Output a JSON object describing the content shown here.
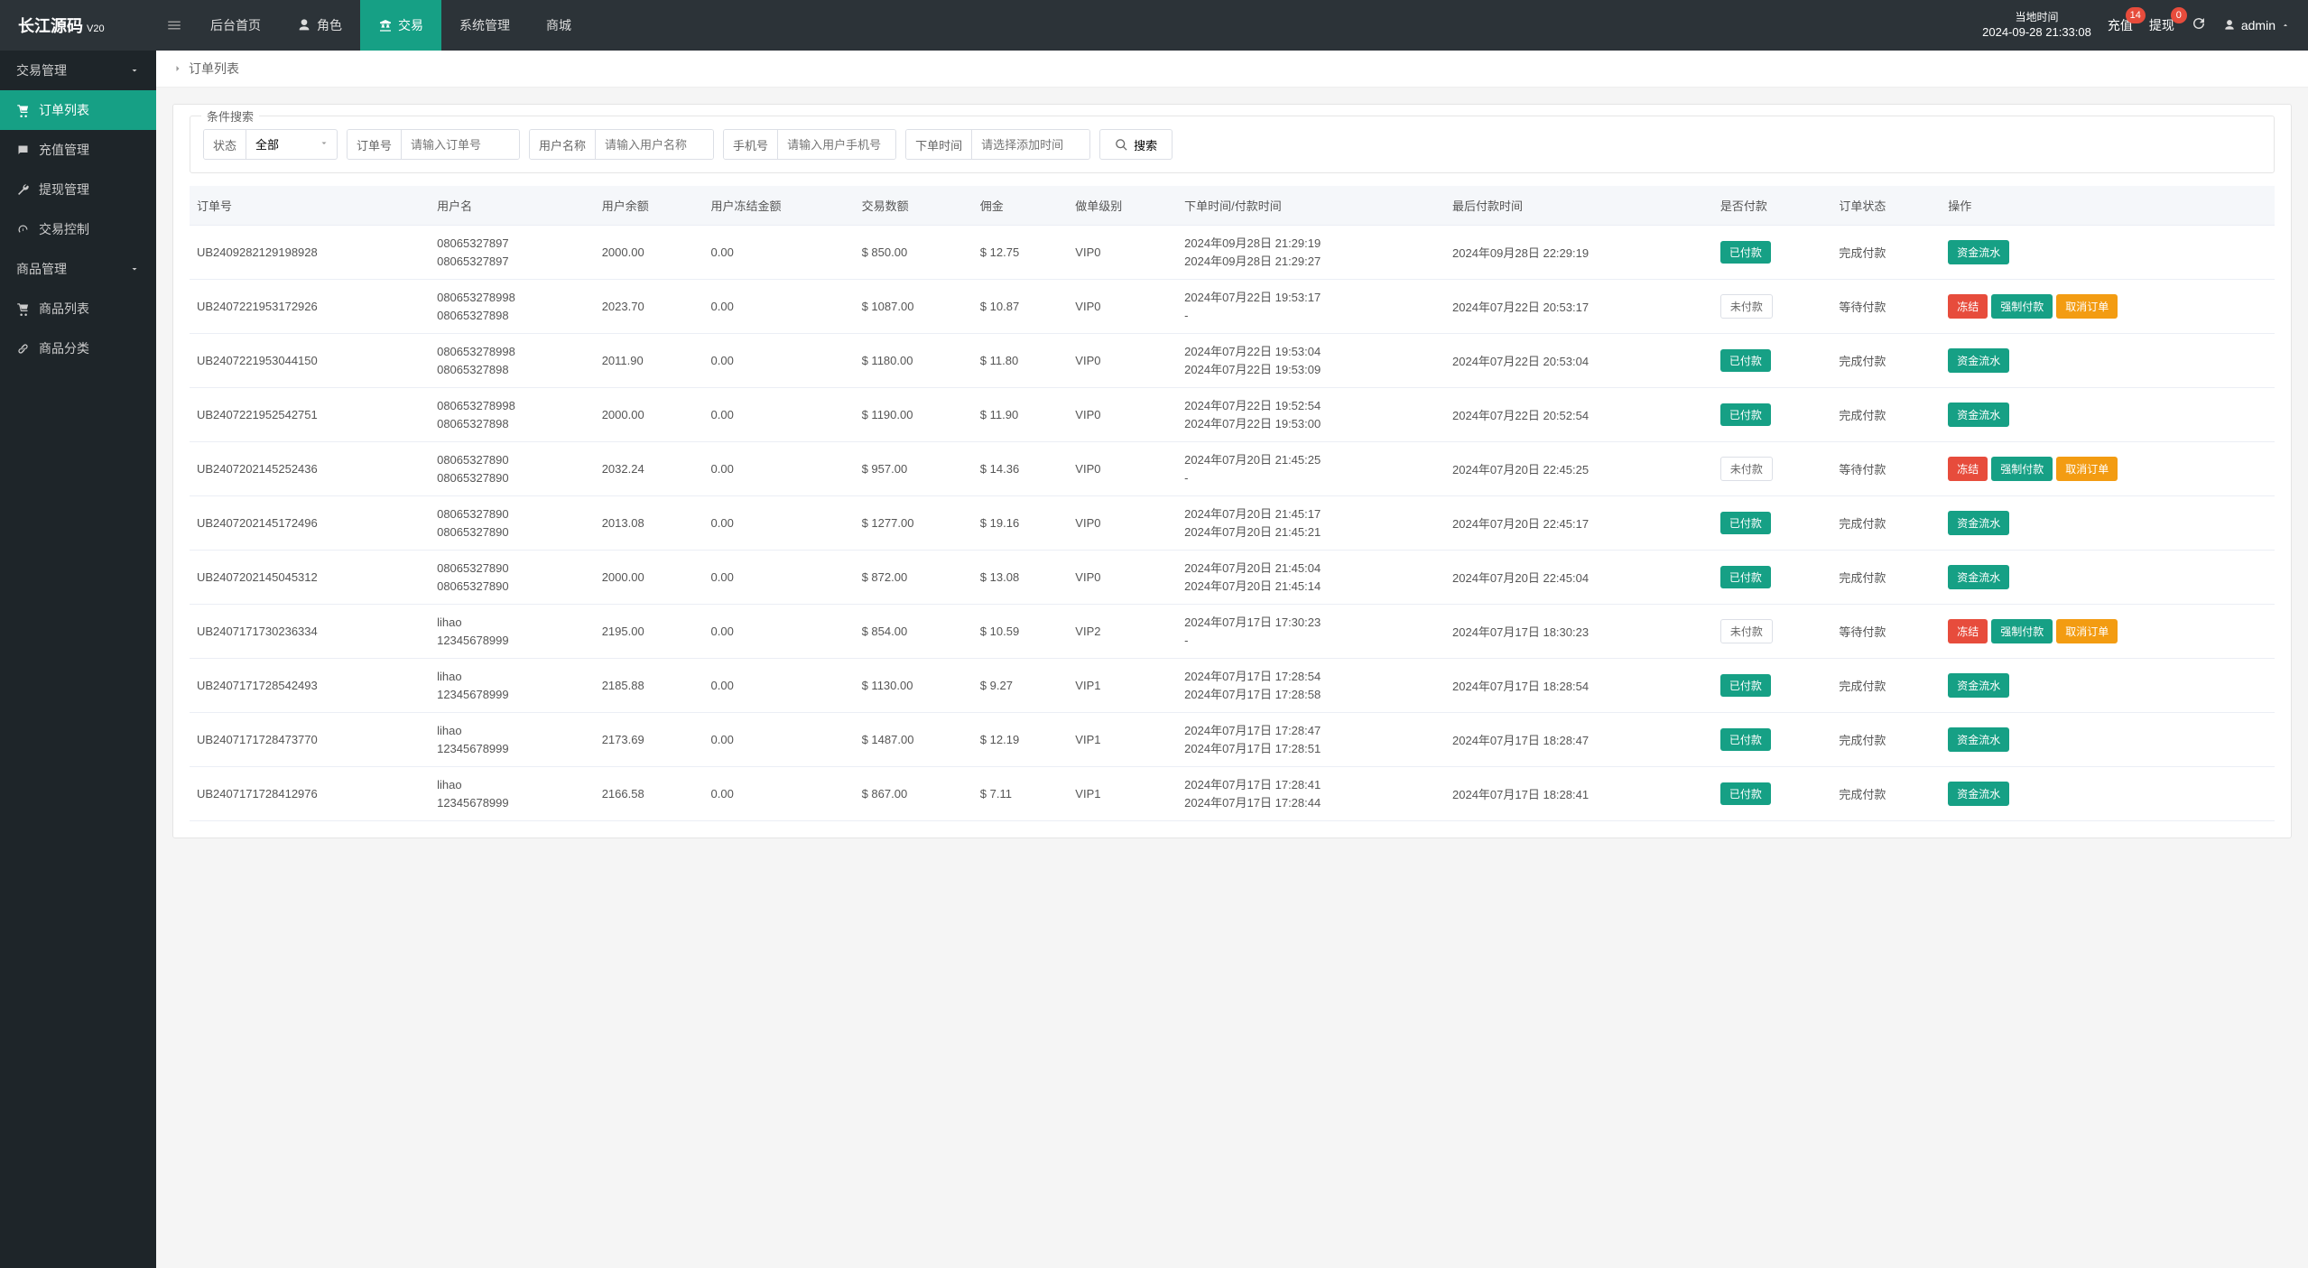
{
  "brand": {
    "name": "长江源码",
    "version": "V20"
  },
  "topnav": [
    {
      "label": "后台首页",
      "icon": null
    },
    {
      "label": "角色",
      "icon": "user"
    },
    {
      "label": "交易",
      "icon": "scale",
      "active": true
    },
    {
      "label": "系统管理",
      "icon": null
    },
    {
      "label": "商城",
      "icon": null
    }
  ],
  "clock": {
    "label": "当地时间",
    "value": "2024-09-28 21:33:08"
  },
  "badges": {
    "recharge_label": "充值",
    "recharge_count": "14",
    "withdraw_label": "提现",
    "withdraw_count": "0"
  },
  "admin": {
    "label": "admin"
  },
  "sidebar": {
    "group1": {
      "label": "交易管理"
    },
    "items1": [
      {
        "label": "订单列表",
        "icon": "cart",
        "active": true
      },
      {
        "label": "充值管理",
        "icon": "comment"
      },
      {
        "label": "提现管理",
        "icon": "wrench"
      },
      {
        "label": "交易控制",
        "icon": "gauge"
      }
    ],
    "group2": {
      "label": "商品管理"
    },
    "items2": [
      {
        "label": "商品列表",
        "icon": "cart"
      },
      {
        "label": "商品分类",
        "icon": "link"
      }
    ]
  },
  "breadcrumb": {
    "title": "订单列表"
  },
  "search": {
    "legend": "条件搜索",
    "status_label": "状态",
    "status_value": "全部",
    "order_label": "订单号",
    "order_placeholder": "请输入订单号",
    "username_label": "用户名称",
    "username_placeholder": "请输入用户名称",
    "phone_label": "手机号",
    "phone_placeholder": "请输入用户手机号",
    "time_label": "下单时间",
    "time_placeholder": "请选择添加时间",
    "search_btn": "搜索"
  },
  "table": {
    "headers": [
      "订单号",
      "用户名",
      "用户余额",
      "用户冻结金额",
      "交易数额",
      "佣金",
      "做单级别",
      "下单时间/付款时间",
      "最后付款时间",
      "是否付款",
      "订单状态",
      "操作"
    ],
    "paid_label": "已付款",
    "unpaid_label": "未付款",
    "done_label": "完成付款",
    "wait_label": "等待付款",
    "flow_label": "资金流水",
    "freeze_label": "冻结",
    "force_label": "强制付款",
    "cancel_label": "取消订单",
    "rows": [
      {
        "id": "UB2409282129198928",
        "user1": "08065327897",
        "user2": "08065327897",
        "bal": "2000.00",
        "frozen": "0.00",
        "amt": "$ 850.00",
        "comm": "$ 12.75",
        "lvl": "VIP0",
        "t1": "2024年09月28日 21:29:19",
        "t2": "2024年09月28日 21:29:27",
        "last": "2024年09月28日 22:29:19",
        "paid": true,
        "done": true
      },
      {
        "id": "UB2407221953172926",
        "user1": "080653278998",
        "user2": "08065327898",
        "bal": "2023.70",
        "frozen": "0.00",
        "amt": "$ 1087.00",
        "comm": "$ 10.87",
        "lvl": "VIP0",
        "t1": "2024年07月22日 19:53:17",
        "t2": "-",
        "last": "2024年07月22日 20:53:17",
        "paid": false,
        "done": false
      },
      {
        "id": "UB2407221953044150",
        "user1": "080653278998",
        "user2": "08065327898",
        "bal": "2011.90",
        "frozen": "0.00",
        "amt": "$ 1180.00",
        "comm": "$ 11.80",
        "lvl": "VIP0",
        "t1": "2024年07月22日 19:53:04",
        "t2": "2024年07月22日 19:53:09",
        "last": "2024年07月22日 20:53:04",
        "paid": true,
        "done": true
      },
      {
        "id": "UB2407221952542751",
        "user1": "080653278998",
        "user2": "08065327898",
        "bal": "2000.00",
        "frozen": "0.00",
        "amt": "$ 1190.00",
        "comm": "$ 11.90",
        "lvl": "VIP0",
        "t1": "2024年07月22日 19:52:54",
        "t2": "2024年07月22日 19:53:00",
        "last": "2024年07月22日 20:52:54",
        "paid": true,
        "done": true
      },
      {
        "id": "UB2407202145252436",
        "user1": "08065327890",
        "user2": "08065327890",
        "bal": "2032.24",
        "frozen": "0.00",
        "amt": "$ 957.00",
        "comm": "$ 14.36",
        "lvl": "VIP0",
        "t1": "2024年07月20日 21:45:25",
        "t2": "-",
        "last": "2024年07月20日 22:45:25",
        "paid": false,
        "done": false
      },
      {
        "id": "UB2407202145172496",
        "user1": "08065327890",
        "user2": "08065327890",
        "bal": "2013.08",
        "frozen": "0.00",
        "amt": "$ 1277.00",
        "comm": "$ 19.16",
        "lvl": "VIP0",
        "t1": "2024年07月20日 21:45:17",
        "t2": "2024年07月20日 21:45:21",
        "last": "2024年07月20日 22:45:17",
        "paid": true,
        "done": true
      },
      {
        "id": "UB2407202145045312",
        "user1": "08065327890",
        "user2": "08065327890",
        "bal": "2000.00",
        "frozen": "0.00",
        "amt": "$ 872.00",
        "comm": "$ 13.08",
        "lvl": "VIP0",
        "t1": "2024年07月20日 21:45:04",
        "t2": "2024年07月20日 21:45:14",
        "last": "2024年07月20日 22:45:04",
        "paid": true,
        "done": true
      },
      {
        "id": "UB2407171730236334",
        "user1": "lihao",
        "user2": "12345678999",
        "bal": "2195.00",
        "frozen": "0.00",
        "amt": "$ 854.00",
        "comm": "$ 10.59",
        "lvl": "VIP2",
        "t1": "2024年07月17日 17:30:23",
        "t2": "-",
        "last": "2024年07月17日 18:30:23",
        "paid": false,
        "done": false
      },
      {
        "id": "UB2407171728542493",
        "user1": "lihao",
        "user2": "12345678999",
        "bal": "2185.88",
        "frozen": "0.00",
        "amt": "$ 1130.00",
        "comm": "$ 9.27",
        "lvl": "VIP1",
        "t1": "2024年07月17日 17:28:54",
        "t2": "2024年07月17日 17:28:58",
        "last": "2024年07月17日 18:28:54",
        "paid": true,
        "done": true
      },
      {
        "id": "UB2407171728473770",
        "user1": "lihao",
        "user2": "12345678999",
        "bal": "2173.69",
        "frozen": "0.00",
        "amt": "$ 1487.00",
        "comm": "$ 12.19",
        "lvl": "VIP1",
        "t1": "2024年07月17日 17:28:47",
        "t2": "2024年07月17日 17:28:51",
        "last": "2024年07月17日 18:28:47",
        "paid": true,
        "done": true
      },
      {
        "id": "UB2407171728412976",
        "user1": "lihao",
        "user2": "12345678999",
        "bal": "2166.58",
        "frozen": "0.00",
        "amt": "$ 867.00",
        "comm": "$ 7.11",
        "lvl": "VIP1",
        "t1": "2024年07月17日 17:28:41",
        "t2": "2024年07月17日 17:28:44",
        "last": "2024年07月17日 18:28:41",
        "paid": true,
        "done": true
      }
    ]
  }
}
